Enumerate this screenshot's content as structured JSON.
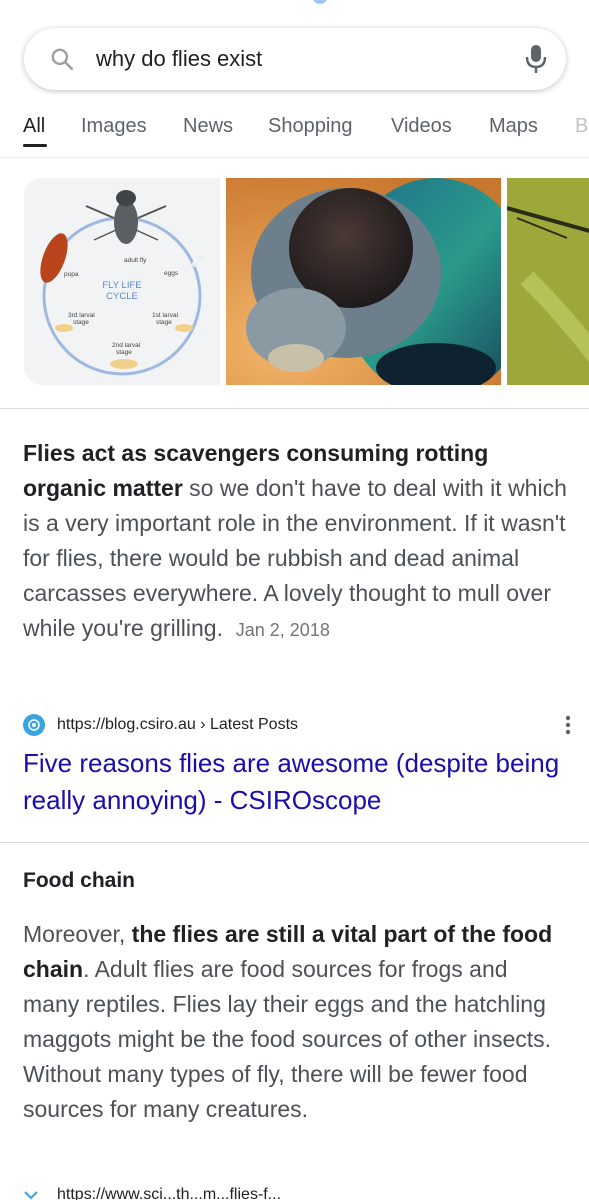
{
  "search": {
    "query": "why do flies exist"
  },
  "tabs": [
    "All",
    "Images",
    "News",
    "Shopping",
    "Videos",
    "Maps",
    "B"
  ],
  "images": {
    "life_cycle": {
      "title_line1": "FLY LIFE",
      "title_line2": "CYCLE",
      "adult_fly": "adult fly",
      "eggs": "eggs",
      "pupa": "pupa",
      "larval3": "3rd larval",
      "larval1": "1st larval",
      "stage": "stage",
      "larval2": "2nd larval"
    }
  },
  "featured_snippet": {
    "bold_text": "Flies act as scavengers consuming rotting organic matter",
    "text": " so we don't have to deal with it which is a very important role in the environment. If it wasn't for flies, there would be rubbish and dead animal carcasses everywhere. A lovely thought to mull over while you're grilling.",
    "date": "Jan 2, 2018",
    "source_url": "https://blog.csiro.au › Latest Posts",
    "title": "Five reasons flies are awesome (despite being really annoying) - CSIROscope"
  },
  "section": {
    "heading": "Food chain",
    "text_before": "Moreover, ",
    "bold_text": "the flies are still a vital part of the food chain",
    "text_after": ". Adult flies are food sources for frogs and many reptiles. Flies lay their eggs and the hatchling maggots might be the food sources of other insects. Without many types of fly, there will be fewer food sources for many creatures."
  },
  "bottom_peek": {
    "url_partial": "https://www.sci...th...m...flies-f..."
  },
  "colors": {
    "link": "#1a0dab",
    "text": "#4d5156",
    "heading": "#202124",
    "tab_inactive": "#5f6368"
  }
}
